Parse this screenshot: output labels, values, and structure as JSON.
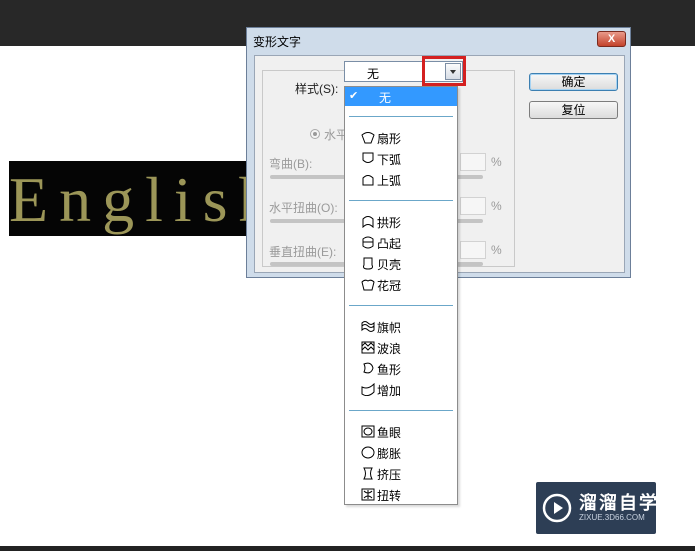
{
  "canvas": {
    "text": "English"
  },
  "dialog": {
    "title": "变形文字",
    "close_label": "X",
    "style_label": "样式(S):",
    "style_value": "无",
    "orientation_label": "水平",
    "bend_label": "弯曲(B):",
    "h_distortion_label": "水平扭曲(O):",
    "v_distortion_label": "垂直扭曲(E):",
    "percent": "%",
    "ok_button": "确定",
    "reset_button": "复位"
  },
  "dropdown": {
    "selected_check": "✔",
    "items": [
      {
        "label": "无",
        "icon": "none",
        "selected": true
      },
      {
        "label": "扇形",
        "icon": "arc-icon"
      },
      {
        "label": "下弧",
        "icon": "arc-lower-icon"
      },
      {
        "label": "上弧",
        "icon": "arc-upper-icon"
      },
      {
        "label": "拱形",
        "icon": "arch-icon"
      },
      {
        "label": "凸起",
        "icon": "bulge-icon"
      },
      {
        "label": "贝壳",
        "icon": "shell-icon"
      },
      {
        "label": "花冠",
        "icon": "flower-icon"
      },
      {
        "label": "旗帜",
        "icon": "flag-icon"
      },
      {
        "label": "波浪",
        "icon": "wave-icon"
      },
      {
        "label": "鱼形",
        "icon": "fish-icon"
      },
      {
        "label": "增加",
        "icon": "rise-icon"
      },
      {
        "label": "鱼眼",
        "icon": "fisheye-icon"
      },
      {
        "label": "膨胀",
        "icon": "inflate-icon"
      },
      {
        "label": "挤压",
        "icon": "squeeze-icon"
      },
      {
        "label": "扭转",
        "icon": "twist-icon"
      }
    ]
  },
  "watermark": {
    "title": "溜溜自学",
    "url": "ZIXUE.3D66.COM"
  },
  "colors": {
    "selection": "#3399ff",
    "highlight_box": "#d42020",
    "canvas_text": "#9c9658"
  }
}
